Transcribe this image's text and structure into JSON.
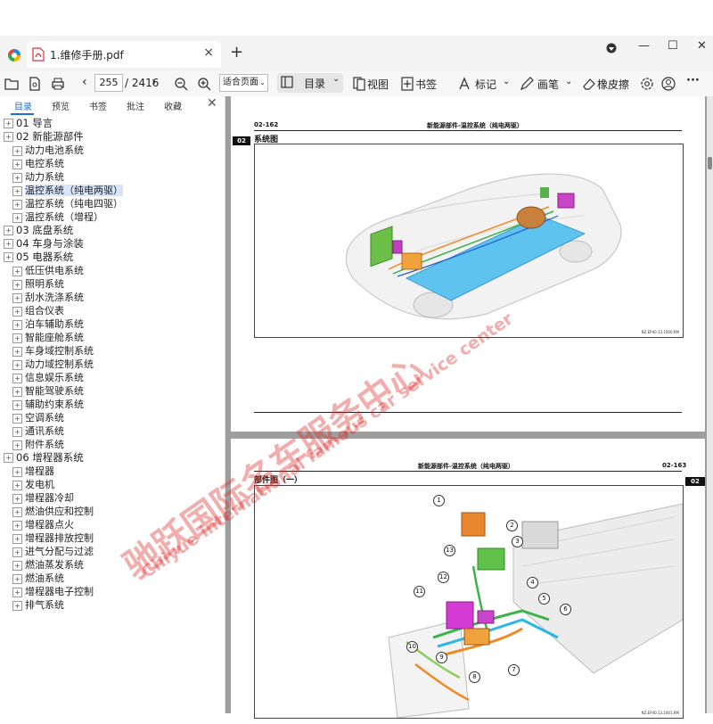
{
  "tab": {
    "title": "1.维修手册.pdf",
    "close": "×",
    "new": "+"
  },
  "window": {
    "minimize": "—",
    "maximize": "☐",
    "close": "✕"
  },
  "toolbar": {
    "page_current": "255",
    "page_total": "/ 2416",
    "zoom": "适合页面",
    "toc": "目录",
    "view": "视图",
    "bookmark": "书签",
    "mark": "标记",
    "pen": "画笔",
    "eraser": "橡皮擦",
    "more": "···"
  },
  "sidebar": {
    "tabs": [
      "目录",
      "预览",
      "书签",
      "批注",
      "收藏"
    ],
    "close": "✕",
    "tree": [
      {
        "label": "01 导言",
        "level": 1
      },
      {
        "label": "02 新能源部件",
        "level": 1
      },
      {
        "label": "动力电池系统",
        "level": 2
      },
      {
        "label": "电控系统",
        "level": 2
      },
      {
        "label": "动力系统",
        "level": 2
      },
      {
        "label": "温控系统（纯电两驱）",
        "level": 2,
        "selected": true
      },
      {
        "label": "温控系统（纯电四驱）",
        "level": 2
      },
      {
        "label": "温控系统（增程）",
        "level": 2
      },
      {
        "label": "03 底盘系统",
        "level": 1
      },
      {
        "label": "04 车身与涂装",
        "level": 1
      },
      {
        "label": "05 电器系统",
        "level": 1
      },
      {
        "label": "低压供电系统",
        "level": 2
      },
      {
        "label": "照明系统",
        "level": 2
      },
      {
        "label": "刮水洗涤系统",
        "level": 2
      },
      {
        "label": "组合仪表",
        "level": 2
      },
      {
        "label": "泊车辅助系统",
        "level": 2
      },
      {
        "label": "智能座舱系统",
        "level": 2
      },
      {
        "label": "车身域控制系统",
        "level": 2
      },
      {
        "label": "动力域控制系统",
        "level": 2
      },
      {
        "label": "信息娱乐系统",
        "level": 2
      },
      {
        "label": "智能驾驶系统",
        "level": 2
      },
      {
        "label": "辅助约束系统",
        "level": 2
      },
      {
        "label": "空调系统",
        "level": 2
      },
      {
        "label": "通讯系统",
        "level": 2
      },
      {
        "label": "附件系统",
        "level": 2
      },
      {
        "label": "06 增程器系统",
        "level": 1
      },
      {
        "label": "增程器",
        "level": 2
      },
      {
        "label": "发电机",
        "level": 2
      },
      {
        "label": "增程器冷却",
        "level": 2
      },
      {
        "label": "燃油供应和控制",
        "level": 2
      },
      {
        "label": "增程器点火",
        "level": 2
      },
      {
        "label": "增程器排放控制",
        "level": 2
      },
      {
        "label": "进气分配与过滤",
        "level": 2
      },
      {
        "label": "燃油蒸发系统",
        "level": 2
      },
      {
        "label": "燃油系统",
        "level": 2
      },
      {
        "label": "增程器电子控制",
        "level": 2
      },
      {
        "label": "排气系统",
        "level": 2
      }
    ]
  },
  "page1": {
    "page_number": "02-162",
    "header": "新能源部件-温控系统（纯电两驱）",
    "section_tag": "02",
    "section_title": "系统图",
    "fig_code": "NZ.EP40.13.1000.RM"
  },
  "page2": {
    "page_number": "02-163",
    "header": "新能源部件-温控系统（纯电两驱）",
    "section_tag": "02",
    "section_title": "部件图（一）",
    "fig_code": "NZ.EP40.13.1001.RM",
    "callouts": [
      "1",
      "2",
      "3",
      "4",
      "5",
      "6",
      "7",
      "8",
      "9",
      "10",
      "11",
      "12",
      "13"
    ]
  },
  "watermark": {
    "cn": "驰跃国际名车服务中心",
    "en": "Chiyue international famous car service center"
  },
  "colors": {
    "accent": "#1e6fd9",
    "selected_bg": "#d8e6fb",
    "watermark": "#dc2828"
  }
}
